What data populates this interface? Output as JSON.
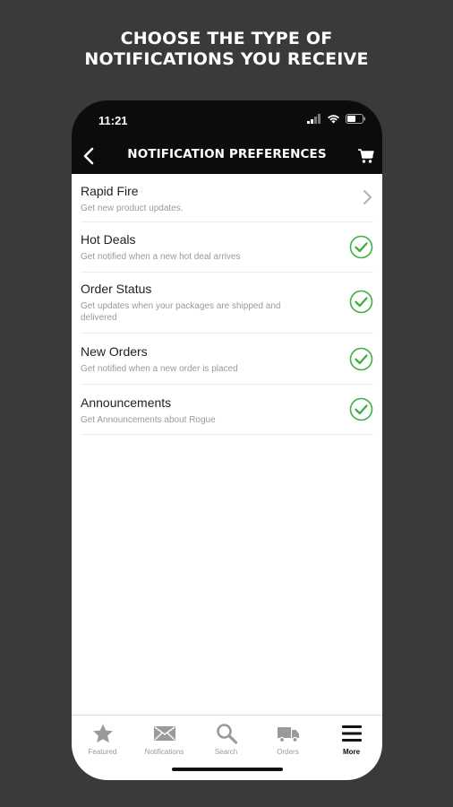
{
  "headline": {
    "line1": "CHOOSE THE TYPE OF",
    "line2": "NOTIFICATIONS YOU RECEIVE"
  },
  "status_bar": {
    "time": "11:21"
  },
  "nav": {
    "title": "NOTIFICATION PREFERENCES"
  },
  "preferences": [
    {
      "title": "Rapid Fire",
      "subtitle": "Get new product updates.",
      "state": "chevron"
    },
    {
      "title": "Hot Deals",
      "subtitle": "Get notified when a new hot deal arrives",
      "state": "checked"
    },
    {
      "title": "Order Status",
      "subtitle": "Get updates when your packages are shipped and delivered",
      "state": "checked"
    },
    {
      "title": "New Orders",
      "subtitle": "Get notified when a new order is placed",
      "state": "checked"
    },
    {
      "title": "Announcements",
      "subtitle": "Get Announcements about Rogue",
      "state": "checked"
    }
  ],
  "tabs": [
    {
      "label": "Featured",
      "icon": "star-icon",
      "active": false
    },
    {
      "label": "Notifications",
      "icon": "envelope-icon",
      "active": false
    },
    {
      "label": "Search",
      "icon": "search-icon",
      "active": false
    },
    {
      "label": "Orders",
      "icon": "truck-icon",
      "active": false
    },
    {
      "label": "More",
      "icon": "menu-icon",
      "active": true
    }
  ],
  "colors": {
    "background": "#3a3a3a",
    "check_green": "#3cb043",
    "tab_inactive": "#9a9a9a"
  }
}
